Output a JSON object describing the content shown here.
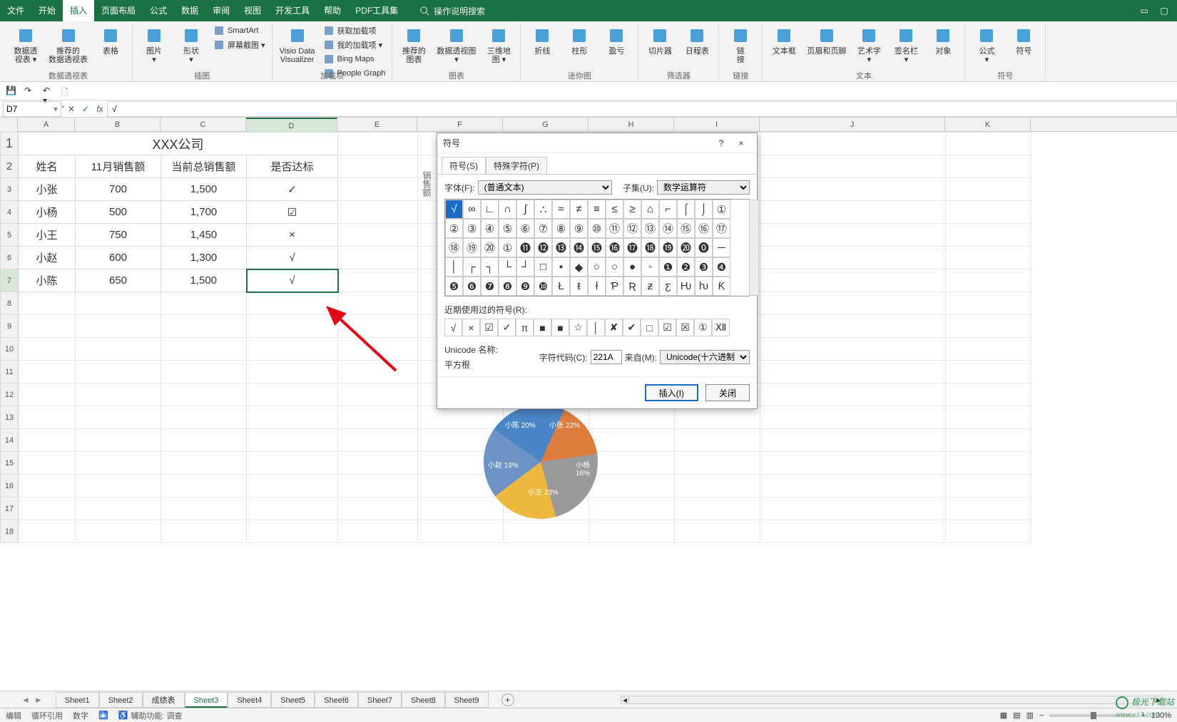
{
  "menubar": {
    "items": [
      "文件",
      "开始",
      "插入",
      "页面布局",
      "公式",
      "数据",
      "审阅",
      "视图",
      "开发工具",
      "帮助",
      "PDF工具集"
    ],
    "active_index": 2,
    "search_placeholder": "操作说明搜索"
  },
  "ribbon": {
    "groups": [
      {
        "label": "数据透视表",
        "buttons_big": [
          {
            "text": "数据透\n视表 ▾",
            "icon": "pivot-icon"
          },
          {
            "text": "推荐的\n数据透视表",
            "icon": "pivot-rec-icon"
          },
          {
            "text": "表格",
            "icon": "table-icon"
          }
        ]
      },
      {
        "label": "插图",
        "buttons_big": [
          {
            "text": "图片\n▾",
            "icon": "picture-icon"
          },
          {
            "text": "形状\n▾",
            "icon": "shapes-icon"
          }
        ],
        "buttons_sm": [
          {
            "text": "SmartArt",
            "icon": "smartart-icon"
          },
          {
            "text": "屏幕截图 ▾",
            "icon": "screenshot-icon"
          }
        ]
      },
      {
        "label": "加载项",
        "buttons_sm": [
          {
            "text": "获取加载项",
            "icon": "store-icon"
          },
          {
            "text": "我的加载项 ▾",
            "icon": "addins-icon"
          }
        ],
        "buttons_big": [
          {
            "text": "Visio Data\nVisualizer",
            "icon": "visio-icon"
          }
        ],
        "buttons_sm2": [
          {
            "text": "Bing Maps",
            "icon": "bing-icon"
          },
          {
            "text": "People Graph",
            "icon": "people-icon"
          }
        ]
      },
      {
        "label": "图表",
        "buttons_big": [
          {
            "text": "推荐的\n图表",
            "icon": "chartrec-icon"
          }
        ],
        "buttons_big2": [
          {
            "text": "数据透视图\n▾",
            "icon": "pivotchart-icon"
          },
          {
            "text": "三维地\n图 ▾",
            "icon": "map3d-icon"
          }
        ]
      },
      {
        "label": "迷你图",
        "buttons_big": [
          {
            "text": "折线",
            "icon": "spark-line-icon"
          },
          {
            "text": "柱形",
            "icon": "spark-col-icon"
          },
          {
            "text": "盈亏",
            "icon": "spark-wl-icon"
          }
        ]
      },
      {
        "label": "筛选器",
        "buttons_big": [
          {
            "text": "切片器",
            "icon": "slicer-icon"
          },
          {
            "text": "日程表",
            "icon": "timeline-icon"
          }
        ]
      },
      {
        "label": "链接",
        "buttons_big": [
          {
            "text": "链\n接",
            "icon": "link-icon"
          }
        ]
      },
      {
        "label": "文本",
        "buttons_big": [
          {
            "text": "文本框",
            "icon": "textbox-icon"
          },
          {
            "text": "页眉和页脚",
            "icon": "headerfooter-icon"
          },
          {
            "text": "艺术字\n▾",
            "icon": "wordart-icon"
          },
          {
            "text": "签名栏\n▾",
            "icon": "sign-icon"
          },
          {
            "text": "对象",
            "icon": "object-icon"
          }
        ]
      },
      {
        "label": "符号",
        "buttons_big": [
          {
            "text": "公式\n▾",
            "icon": "equation-icon"
          },
          {
            "text": "符号",
            "icon": "symbol-icon"
          }
        ]
      }
    ]
  },
  "qat": {
    "save": "保存",
    "redo": "重做",
    "undo": "撤消"
  },
  "namebox": "D7",
  "formula": "√",
  "columns": [
    "A",
    "B",
    "C",
    "D",
    "E",
    "F",
    "G",
    "H",
    "I",
    "J",
    "K"
  ],
  "row_count": 18,
  "table": {
    "title": "XXX公司",
    "headers": [
      "姓名",
      "11月销售额",
      "当前总销售额",
      "是否达标"
    ],
    "rows": [
      [
        "小张",
        "700",
        "1,500",
        "✓"
      ],
      [
        "小杨",
        "500",
        "1,700",
        "☑"
      ],
      [
        "小王",
        "750",
        "1,450",
        "×"
      ],
      [
        "小赵",
        "600",
        "1,300",
        "√"
      ],
      [
        "小陈",
        "650",
        "1,500",
        "√"
      ]
    ]
  },
  "pie_side_label": "销售额",
  "dialog": {
    "title": "符号",
    "help_btn": "?",
    "close_btn": "×",
    "tabs": [
      {
        "label": "符号(S)"
      },
      {
        "label": "特殊字符(P)"
      }
    ],
    "active_tab": 0,
    "font_label": "字体(F):",
    "font_value": "(普通文本)",
    "subset_label": "子集(U):",
    "subset_value": "数学运算符",
    "grid": [
      [
        "√",
        "∞",
        "∟",
        "∩",
        "∫",
        "∴",
        "≈",
        "≠",
        "≡",
        "≤",
        "≥",
        "⌂",
        "⌐",
        "⌠",
        "⌡",
        "①",
        "②"
      ],
      [
        "③",
        "④",
        "⑤",
        "⑥",
        "⑦",
        "⑧",
        "⑨",
        "⑩",
        "⑪",
        "⑫",
        "⑬",
        "⑭",
        "⑮",
        "⑯",
        "⑰",
        "⑱"
      ],
      [
        "⑲",
        "⑳",
        "①",
        "⓫",
        "⓬",
        "⓭",
        "⓮",
        "⓯",
        "⓰",
        "⓱",
        "⓲",
        "⓳",
        "⓴",
        "⓿",
        "─",
        "│"
      ],
      [
        "┌",
        "┐",
        "└",
        "┘",
        "□",
        "▪",
        "◆",
        "○",
        "○",
        "●",
        "◦",
        "❶",
        "❷",
        "❸",
        "❹"
      ],
      [
        "❺",
        "❻",
        "❼",
        "❽",
        "❾",
        "❿",
        "Ł",
        "ŧ",
        "ł",
        "Ƥ",
        "Ʀ",
        "ƶ",
        "ƹ",
        "Ƕ",
        "ƕ",
        "Ƙ"
      ]
    ],
    "selected": [
      0,
      0
    ],
    "recent_label": "近期使用过的符号(R):",
    "recent": [
      "√",
      "×",
      "☑",
      "✓",
      "π",
      "■",
      "■",
      "☆",
      "│",
      "✘",
      "✔",
      "□",
      "☑",
      "☒",
      "①",
      "Ⅻ"
    ],
    "unicode_name_label": "Unicode 名称:",
    "unicode_name": "平方根",
    "charcode_label": "字符代码(C):",
    "charcode": "221A",
    "from_label": "来自(M):",
    "from_value": "Unicode(十六进制)",
    "insert_btn": "插入(I)",
    "close_btn2": "关闭"
  },
  "sheet_tabs": [
    "Sheet1",
    "Sheet2",
    "成绩表",
    "Sheet3",
    "Sheet4",
    "Sheet5",
    "Sheet6",
    "Sheet7",
    "Sheet8",
    "Sheet9"
  ],
  "active_sheet": 3,
  "status": {
    "ready": "编辑",
    "circular": "循环引用",
    "num": "数字",
    "acc": "辅助功能: 调查",
    "zoom": "100%"
  },
  "watermark": {
    "brand": "极光下载站",
    "url": "www.xz7.com"
  },
  "chart_data": {
    "type": "pie",
    "title": "销售额",
    "series": [
      {
        "name": "销售额",
        "values": [
          22,
          16,
          23,
          19,
          20
        ]
      }
    ],
    "categories": [
      "小张",
      "小杨",
      "小王",
      "小赵",
      "小陈"
    ],
    "labels": [
      "小张\n22%",
      "小杨\n16%",
      "小王\n23%",
      "小赵\n19%",
      "小陈\n20%"
    ],
    "colors": [
      "#4a86c5",
      "#de7c3e",
      "#9a9a9a",
      "#eeb83e",
      "#6b93c6"
    ]
  }
}
